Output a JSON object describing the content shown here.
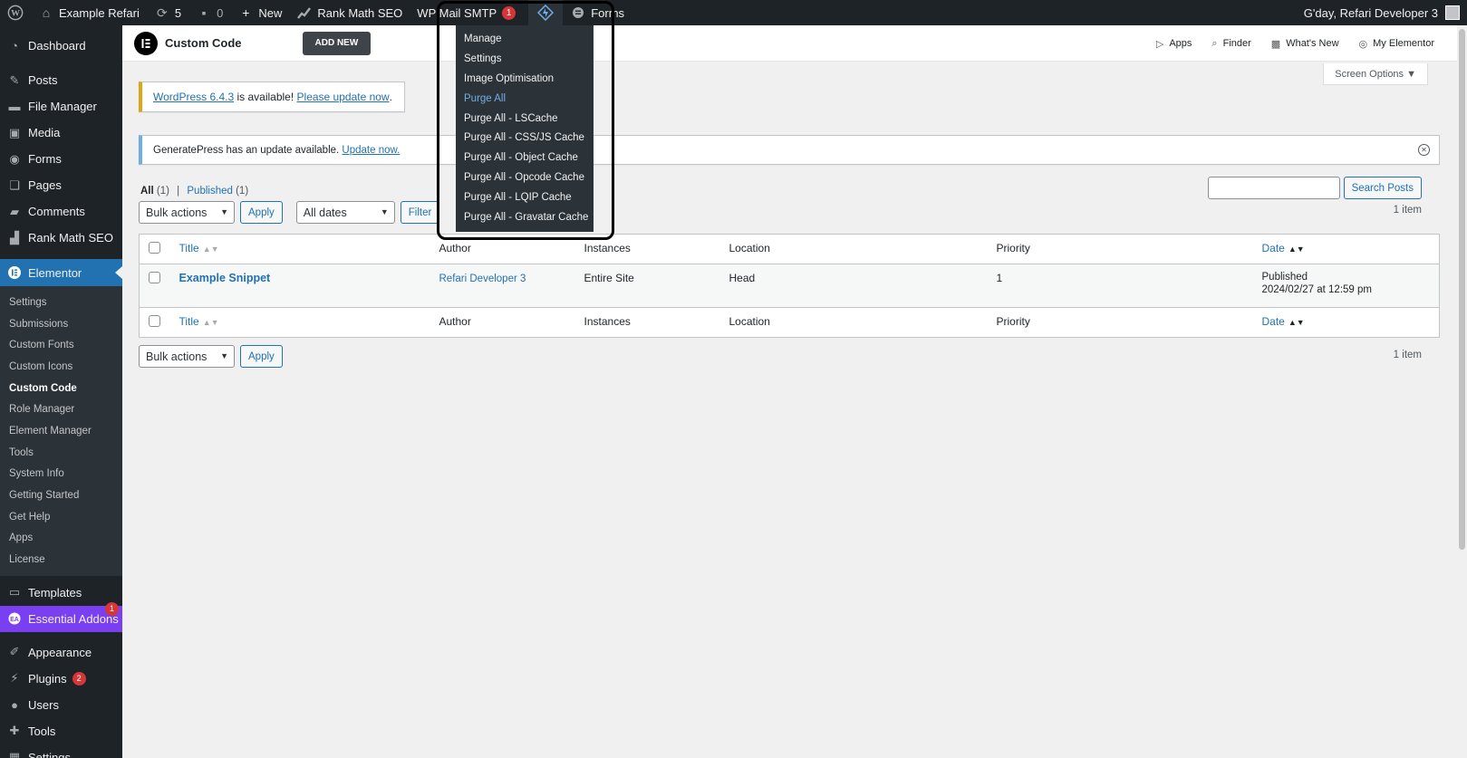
{
  "adminbar": {
    "site_name": "Example Refari",
    "updates_count": "5",
    "comments_count": "0",
    "new_label": "New",
    "rankmath_label": "Rank Math SEO",
    "wpmail_label": "WP Mail SMTP",
    "wpmail_badge": "1",
    "forms_label": "Forms",
    "greeting": "G'day, Refari Developer 3"
  },
  "dropdown": {
    "items": [
      "Manage",
      "Settings",
      "Image Optimisation",
      "Purge All",
      "Purge All - LSCache",
      "Purge All - CSS/JS Cache",
      "Purge All - Object Cache",
      "Purge All - Opcode Cache",
      "Purge All - LQIP Cache",
      "Purge All - Gravatar Cache"
    ],
    "highlight_color": "#72aee6"
  },
  "sidebar": {
    "items": [
      {
        "label": "Dashboard",
        "icon": "dashboard-icon"
      },
      {
        "label": "Posts",
        "icon": "pin-icon"
      },
      {
        "label": "File Manager",
        "icon": "folder-icon"
      },
      {
        "label": "Media",
        "icon": "media-icon"
      },
      {
        "label": "Forms",
        "icon": "forms-icon"
      },
      {
        "label": "Pages",
        "icon": "pages-icon"
      },
      {
        "label": "Comments",
        "icon": "comment-icon"
      },
      {
        "label": "Rank Math SEO",
        "icon": "chart-icon"
      },
      {
        "label": "Elementor",
        "icon": "elementor-icon"
      }
    ],
    "submenu": [
      "Settings",
      "Submissions",
      "Custom Fonts",
      "Custom Icons",
      "Custom Code",
      "Role Manager",
      "Element Manager",
      "Tools",
      "System Info",
      "Getting Started",
      "Get Help",
      "Apps",
      "License"
    ],
    "current_sub": "Custom Code",
    "lower_items": [
      {
        "label": "Templates",
        "icon": "folder-open-icon"
      },
      {
        "label": "Essential Addons",
        "icon": "ea-icon",
        "badge": "1"
      },
      {
        "label": "Appearance",
        "icon": "brush-icon"
      },
      {
        "label": "Plugins",
        "icon": "plugin-icon",
        "badge": "2"
      },
      {
        "label": "Users",
        "icon": "user-icon"
      },
      {
        "label": "Tools",
        "icon": "wrench-icon"
      },
      {
        "label": "Settings",
        "icon": "settings-icon"
      }
    ],
    "active_color": "#2271b1",
    "ea_color": "#7b3ff2"
  },
  "el_header": {
    "logo_letter": "E",
    "title": "Custom Code",
    "add_new": "ADD NEW",
    "links": [
      "Apps",
      "Finder",
      "What's New",
      "My Elementor"
    ]
  },
  "content": {
    "screen_options": "Screen Options ▼",
    "notice_wp": {
      "link": "WordPress 6.4.3",
      "middle": " is available! ",
      "update_link": "Please update now",
      "end": "."
    },
    "notice_gp": {
      "text": "GeneratePress has an update available. ",
      "link": "Update now."
    },
    "filters": {
      "all": "All",
      "all_count": "(1)",
      "sep": "|",
      "published": "Published",
      "published_count": "(1)"
    },
    "search_button": "Search Posts",
    "bulk_actions": "Bulk actions",
    "apply": "Apply",
    "all_dates": "All dates",
    "filter": "Filter",
    "item_count": "1 item"
  },
  "table": {
    "headers": [
      "Title",
      "Author",
      "Instances",
      "Location",
      "Priority",
      "Date"
    ],
    "rows": [
      {
        "title": "Example Snippet",
        "author": "Refari Developer 3",
        "instances": "Entire Site",
        "location": "Head",
        "priority": "1",
        "date_status": "Published",
        "date": "2024/02/27 at 12:59 pm"
      }
    ]
  }
}
